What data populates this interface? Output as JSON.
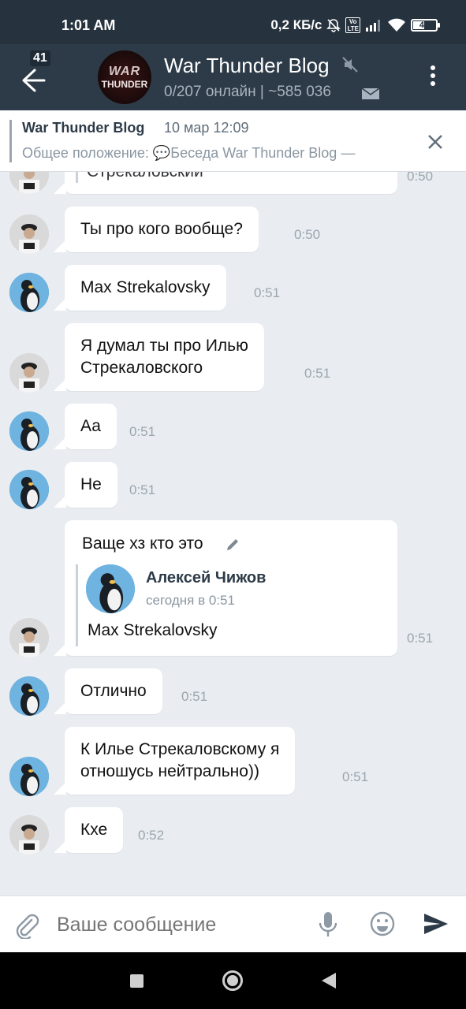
{
  "status_bar": {
    "time": "1:01 AM",
    "speed": "0,2 КБ/с",
    "lte_top": "Vo",
    "lte_bottom": "LTE",
    "battery": "49",
    "battery_level": 0.49,
    "icons": [
      "mute-bell-icon",
      "volte-icon",
      "signal-icon",
      "wifi-icon",
      "battery-icon"
    ]
  },
  "header": {
    "back_badge": "41",
    "avatar_line1": "WAR",
    "avatar_line2": "THUNDER",
    "title": "War Thunder Blog",
    "subtitle": "0/207 онлайн | ~585 036",
    "icons": [
      "back-arrow-icon",
      "muted-icon",
      "mail-icon",
      "more-vertical-icon"
    ]
  },
  "pinned": {
    "name": "War Thunder Blog",
    "date": "10 мар 12:09",
    "text": "Общее положение:  💬Беседа War Thunder Blog —"
  },
  "messages": [
    {
      "sender": "officer",
      "text": "Стрекаловский",
      "time": "0:50"
    },
    {
      "sender": "officer",
      "text": "Ты про кого вообще?",
      "time": "0:50"
    },
    {
      "sender": "penguin",
      "text": "Max Strekalovsky",
      "time": "0:51"
    },
    {
      "sender": "officer",
      "lines": [
        "Я думал ты про Илью",
        "Стрекаловского"
      ],
      "time": "0:51"
    },
    {
      "sender": "penguin",
      "text": "Аа",
      "time": "0:51"
    },
    {
      "sender": "penguin",
      "text": "Не",
      "time": "0:51"
    },
    {
      "sender": "officer",
      "text": "Ваще хз кто это",
      "time": "0:51",
      "reply": {
        "name": "Алексей Чижов",
        "date": "сегодня в 0:51",
        "text": "Max Strekalovsky"
      }
    },
    {
      "sender": "penguin",
      "text": "Отлично",
      "time": "0:51"
    },
    {
      "sender": "penguin",
      "lines": [
        "К Илье Стрекаловскому я",
        "отношусь нейтрально))"
      ],
      "time": "0:51"
    },
    {
      "sender": "officer",
      "text": "Кхе",
      "time": "0:52"
    }
  ],
  "composer": {
    "placeholder": "Ваше сообщение"
  },
  "colors": {
    "header_bg": "#2d3b48",
    "status_bg": "#26333f",
    "chat_bg": "#e9edf1",
    "bubble_bg": "#ffffff",
    "accent": "#2d3b48"
  }
}
